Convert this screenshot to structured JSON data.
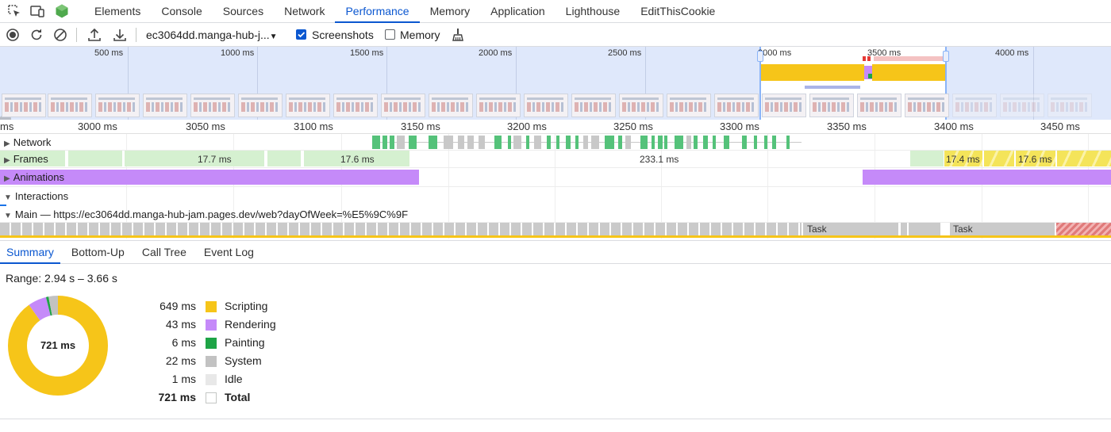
{
  "tabs": [
    {
      "label": "Elements"
    },
    {
      "label": "Console"
    },
    {
      "label": "Sources"
    },
    {
      "label": "Network"
    },
    {
      "label": "Performance",
      "active": true
    },
    {
      "label": "Memory"
    },
    {
      "label": "Application"
    },
    {
      "label": "Lighthouse"
    },
    {
      "label": "EditThisCookie"
    }
  ],
  "toolbar": {
    "profile_select": "ec3064dd.manga-hub-j...",
    "screenshots_label": "Screenshots",
    "screenshots_checked": true,
    "memory_label": "Memory",
    "memory_checked": false
  },
  "overview": {
    "ticks": [
      "500 ms",
      "1000 ms",
      "1500 ms",
      "2000 ms",
      "2500 ms",
      "3000 ms",
      "3500 ms",
      "4000 ms"
    ]
  },
  "ruler": {
    "ticks": [
      "ms",
      "3000 ms",
      "3050 ms",
      "3100 ms",
      "3150 ms",
      "3200 ms",
      "3250 ms",
      "3300 ms",
      "3350 ms",
      "3400 ms",
      "3450 ms"
    ]
  },
  "tracks": {
    "network": "Network",
    "frames": "Frames",
    "animations": "Animations",
    "interactions": "Interactions",
    "main": "Main — https://ec3064dd.manga-hub-jam.pages.dev/web?dayOfWeek=%E5%9C%9F"
  },
  "frames": {
    "labels": [
      "17.7 ms",
      "17.6 ms",
      "233.1 ms",
      "17.4 ms",
      "17.6 ms"
    ]
  },
  "main_tasks": {
    "labels": [
      "Task",
      "Task"
    ]
  },
  "bottom_tabs": [
    {
      "label": "Summary",
      "active": true
    },
    {
      "label": "Bottom-Up"
    },
    {
      "label": "Call Tree"
    },
    {
      "label": "Event Log"
    }
  ],
  "summary": {
    "range": "Range: 2.94 s – 3.66 s",
    "total_center": "721 ms",
    "categories": [
      {
        "value": "649 ms",
        "name": "Scripting",
        "ms": 649,
        "color": "#f6c519"
      },
      {
        "value": "43 ms",
        "name": "Rendering",
        "ms": 43,
        "color": "#c58af9"
      },
      {
        "value": "6 ms",
        "name": "Painting",
        "ms": 6,
        "color": "#1ea446"
      },
      {
        "value": "22 ms",
        "name": "System",
        "ms": 22,
        "color": "#c2c2c2"
      },
      {
        "value": "1 ms",
        "name": "Idle",
        "ms": 1,
        "color": "#e8e8e8"
      }
    ],
    "total": {
      "value": "721 ms",
      "name": "Total"
    }
  }
}
